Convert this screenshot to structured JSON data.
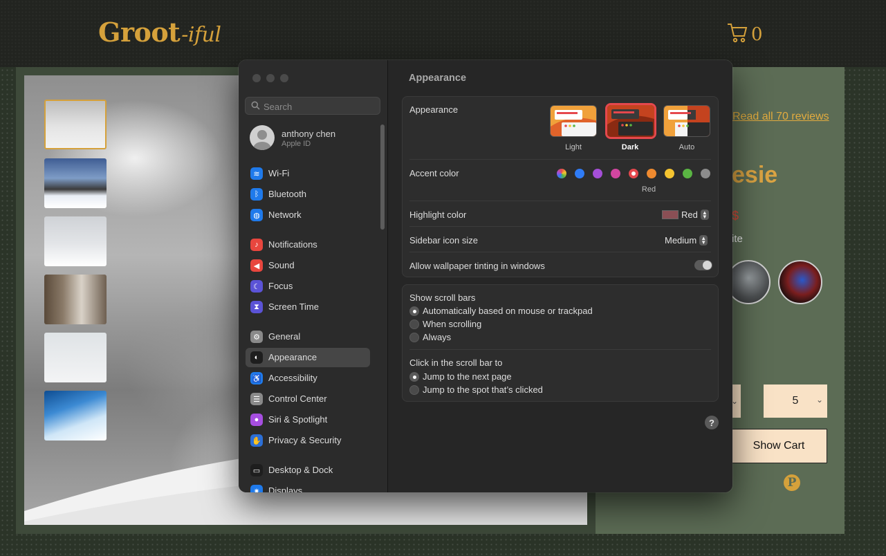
{
  "site": {
    "logo_main": "Groot",
    "logo_suffix": "-iful",
    "cart_count": "0",
    "reviews_link": "Read all 70 reviews",
    "title_fragment": "esie",
    "color_fragment": "ite",
    "quantity_value": "5",
    "show_cart_button": "Show Cart"
  },
  "settings": {
    "search_placeholder": "Search",
    "user": {
      "name": "anthony chen",
      "subtitle": "Apple ID"
    },
    "sidebar": [
      {
        "label": "Wi-Fi",
        "icon": "wifi-icon",
        "color": "#1f7aeb"
      },
      {
        "label": "Bluetooth",
        "icon": "bluetooth-icon",
        "color": "#1f7aeb"
      },
      {
        "label": "Network",
        "icon": "globe-icon",
        "color": "#1f7aeb"
      },
      {
        "label": "Notifications",
        "icon": "bell-icon",
        "color": "#e8463e"
      },
      {
        "label": "Sound",
        "icon": "speaker-icon",
        "color": "#e8463e"
      },
      {
        "label": "Focus",
        "icon": "moon-icon",
        "color": "#5b53d6"
      },
      {
        "label": "Screen Time",
        "icon": "hourglass-icon",
        "color": "#5b53d6"
      },
      {
        "label": "General",
        "icon": "gear-icon",
        "color": "#8a8a8a"
      },
      {
        "label": "Appearance",
        "icon": "appearance-icon",
        "color": "#1e1e1e"
      },
      {
        "label": "Accessibility",
        "icon": "accessibility-icon",
        "color": "#1f7aeb"
      },
      {
        "label": "Control Center",
        "icon": "control-center-icon",
        "color": "#8a8a8a"
      },
      {
        "label": "Siri & Spotlight",
        "icon": "siri-icon",
        "color": "#a64ee0"
      },
      {
        "label": "Privacy & Security",
        "icon": "hand-icon",
        "color": "#2c6fd6"
      },
      {
        "label": "Desktop & Dock",
        "icon": "dock-icon",
        "color": "#1e1e1e"
      },
      {
        "label": "Displays",
        "icon": "display-icon",
        "color": "#1f7aeb"
      }
    ],
    "selected_sidebar": "Appearance",
    "content_title": "Appearance",
    "appearance_label": "Appearance",
    "appearance_options": [
      "Light",
      "Dark",
      "Auto"
    ],
    "appearance_selected": "Dark",
    "accent_label": "Accent color",
    "accent_colors": [
      "multicolor",
      "#2f7cf6",
      "#a54fd8",
      "#d246a0",
      "#e5484d",
      "#ef8a2f",
      "#f5c430",
      "#5ab543",
      "#8c8c8c"
    ],
    "accent_selected_name": "Red",
    "highlight_label": "Highlight color",
    "highlight_value": "Red",
    "highlight_swatch": "#8a4f55",
    "icon_size_label": "Sidebar icon size",
    "icon_size_value": "Medium",
    "tinting_label": "Allow wallpaper tinting in windows",
    "tinting_on": false,
    "scrollbars_label": "Show scroll bars",
    "scrollbar_options": [
      "Automatically based on mouse or trackpad",
      "When scrolling",
      "Always"
    ],
    "scrollbar_selected": 0,
    "click_label": "Click in the scroll bar to",
    "click_options": [
      "Jump to the next page",
      "Jump to the spot that’s clicked"
    ],
    "click_selected": 0,
    "help_label": "?"
  }
}
